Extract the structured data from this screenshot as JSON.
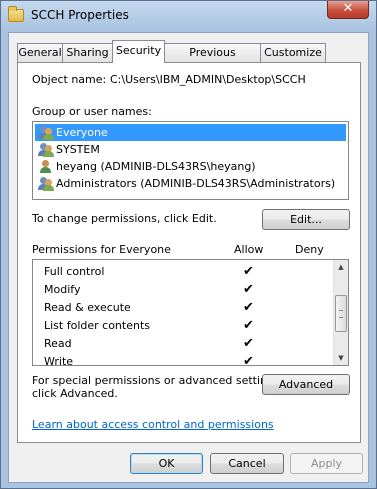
{
  "window": {
    "title": "SCCH Properties",
    "close_glyph": "✕"
  },
  "tabs": [
    {
      "label": "General"
    },
    {
      "label": "Sharing"
    },
    {
      "label": "Security",
      "active": true
    },
    {
      "label": "Previous Versions"
    },
    {
      "label": "Customize"
    }
  ],
  "security": {
    "object_name_label": "Object name:",
    "object_name_value": "C:\\Users\\IBM_ADMIN\\Desktop\\SCCH",
    "group_label": "Group or user names:",
    "groups": [
      {
        "name": "Everyone",
        "icon": "group-icon",
        "selected": true
      },
      {
        "name": "SYSTEM",
        "icon": "group-icon"
      },
      {
        "name": "heyang (ADMINIB-DLS43RS\\heyang)",
        "icon": "user-icon"
      },
      {
        "name": "Administrators (ADMINIB-DLS43RS\\Administrators)",
        "icon": "group-icon"
      }
    ],
    "change_text": "To change permissions, click Edit.",
    "edit_button": "Edit...",
    "permissions_header": "Permissions for Everyone",
    "allow_header": "Allow",
    "deny_header": "Deny",
    "permissions": [
      {
        "name": "Full control",
        "allow": "✔",
        "deny": ""
      },
      {
        "name": "Modify",
        "allow": "✔",
        "deny": ""
      },
      {
        "name": "Read & execute",
        "allow": "✔",
        "deny": ""
      },
      {
        "name": "List folder contents",
        "allow": "✔",
        "deny": ""
      },
      {
        "name": "Read",
        "allow": "✔",
        "deny": ""
      },
      {
        "name": "Write",
        "allow": "✔",
        "deny": ""
      }
    ],
    "advanced_text_1": "For special permissions or advanced settings,",
    "advanced_text_2": "click Advanced.",
    "advanced_button": "Advanced",
    "learn_link": "Learn about access control and permissions"
  },
  "footer": {
    "ok": "OK",
    "cancel": "Cancel",
    "apply": "Apply"
  },
  "colors": {
    "selection": "#3399ff",
    "link": "#0066cc",
    "close": "#c7503f"
  }
}
